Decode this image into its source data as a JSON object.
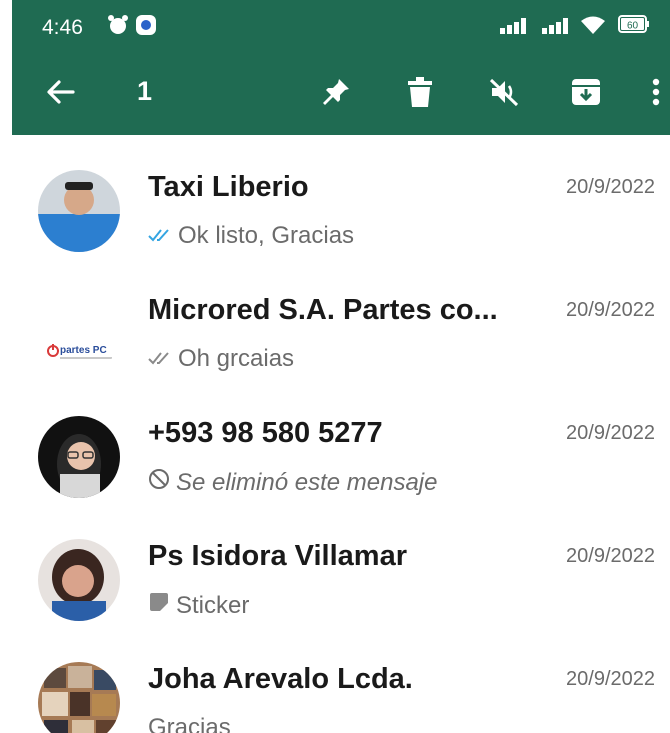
{
  "status_bar": {
    "time": "4:46",
    "battery": "60"
  },
  "toolbar": {
    "selected_count": "1"
  },
  "chats": [
    {
      "name": "Taxi Liberio",
      "date": "20/9/2022",
      "preview": "Ok listo, Gracias",
      "preview_icon": "double-check-read-icon"
    },
    {
      "name": "Microred S.A. Partes co...",
      "date": "20/9/2022",
      "preview": "Oh grcaias",
      "preview_icon": "double-check-icon",
      "avatar_logo_text": "partes PC"
    },
    {
      "name": "+593 98 580 5277",
      "date": "20/9/2022",
      "preview": "Se eliminó este mensaje",
      "preview_icon": "deleted-icon"
    },
    {
      "name": "Ps Isidora Villamar",
      "date": "20/9/2022",
      "preview": "Sticker",
      "preview_icon": "sticker-icon"
    },
    {
      "name": "Joha Arevalo Lcda.",
      "date": "20/9/2022",
      "preview": "Gracias"
    }
  ],
  "colors": {
    "header": "#1f6b52",
    "read_check": "#34a5e2"
  }
}
